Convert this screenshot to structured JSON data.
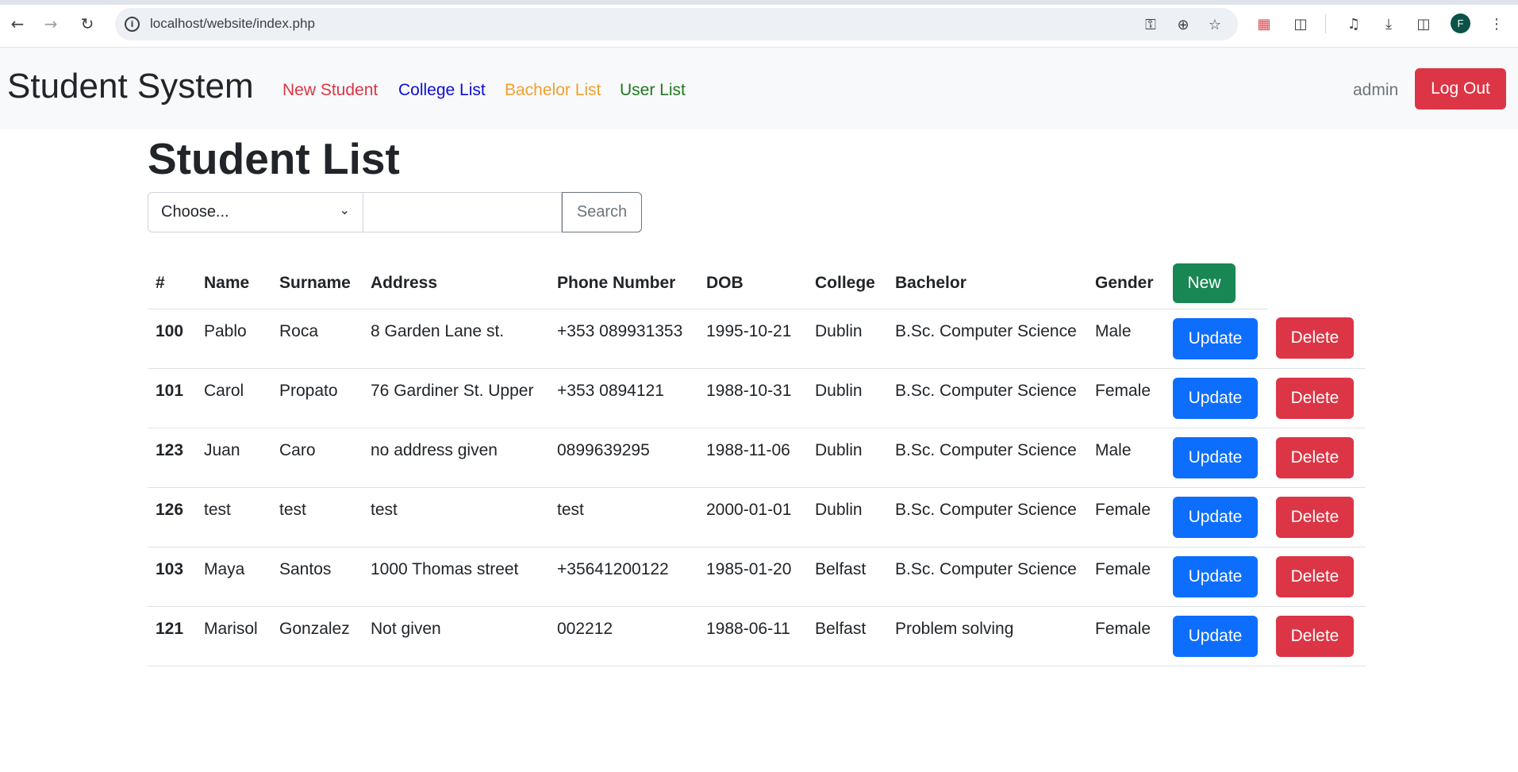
{
  "browser": {
    "url": "localhost/website/index.php",
    "profile_initial": "F"
  },
  "navbar": {
    "brand": "Student System",
    "links": [
      {
        "label": "New Student",
        "color": "#dc3545"
      },
      {
        "label": "College List",
        "color": "#0d0dd6"
      },
      {
        "label": "Bachelor List",
        "color": "#f0a030"
      },
      {
        "label": "User List",
        "color": "#1f7a1f"
      }
    ],
    "user": "admin",
    "logout_label": "Log Out"
  },
  "main": {
    "title": "Student List",
    "search": {
      "select_value": "Choose...",
      "input_value": "",
      "button_label": "Search"
    },
    "table": {
      "headers": [
        "#",
        "Name",
        "Surname",
        "Address",
        "Phone Number",
        "DOB",
        "College",
        "Bachelor",
        "Gender"
      ],
      "new_label": "New",
      "update_label": "Update",
      "delete_label": "Delete",
      "rows": [
        [
          "100",
          "Pablo",
          "Roca",
          "8 Garden Lane st.",
          "+353 089931353",
          "1995-10-21",
          "Dublin",
          "B.Sc. Computer Science",
          "Male"
        ],
        [
          "101",
          "Carol",
          "Propato",
          "76 Gardiner St. Upper",
          "+353 0894121",
          "1988-10-31",
          "Dublin",
          "B.Sc. Computer Science",
          "Female"
        ],
        [
          "123",
          "Juan",
          "Caro",
          "no address given",
          "0899639295",
          "1988-11-06",
          "Dublin",
          "B.Sc. Computer Science",
          "Male"
        ],
        [
          "126",
          "test",
          "test",
          "test",
          "test",
          "2000-01-01",
          "Dublin",
          "B.Sc. Computer Science",
          "Female"
        ],
        [
          "103",
          "Maya",
          "Santos",
          "1000 Thomas street",
          "+35641200122",
          "1985-01-20",
          "Belfast",
          "B.Sc. Computer Science",
          "Female"
        ],
        [
          "121",
          "Marisol",
          "Gonzalez",
          "Not given",
          "002212",
          "1988-06-11",
          "Belfast",
          "Problem solving",
          "Female"
        ]
      ]
    }
  }
}
